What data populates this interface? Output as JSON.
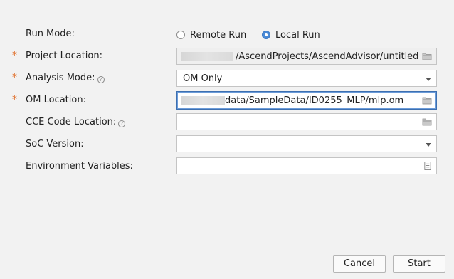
{
  "run_mode": {
    "label": "Run Mode:",
    "options": [
      {
        "label": "Remote Run",
        "selected": false
      },
      {
        "label": "Local Run",
        "selected": true
      }
    ]
  },
  "fields": {
    "project_location": {
      "label": "Project Location:",
      "required": true,
      "value": "/AscendProjects/AscendAdvisor/untitled"
    },
    "analysis_mode": {
      "label": "Analysis Mode:",
      "required": true,
      "value": "OM Only"
    },
    "om_location": {
      "label": "OM Location:",
      "required": true,
      "value": "data/SampleData/ID0255_MLP/mlp.om"
    },
    "cce_code_location": {
      "label": "CCE Code Location:",
      "required": false,
      "value": ""
    },
    "soc_version": {
      "label": "SoC Version:",
      "required": false,
      "value": ""
    },
    "environment_variables": {
      "label": "Environment Variables:",
      "required": false,
      "value": ""
    }
  },
  "required_marker": "*",
  "help_glyph": "?",
  "buttons": {
    "cancel": "Cancel",
    "start": "Start"
  },
  "colors": {
    "accent": "#4a8ad6",
    "required": "#e0702c",
    "focus_border": "#3d6fb0"
  }
}
